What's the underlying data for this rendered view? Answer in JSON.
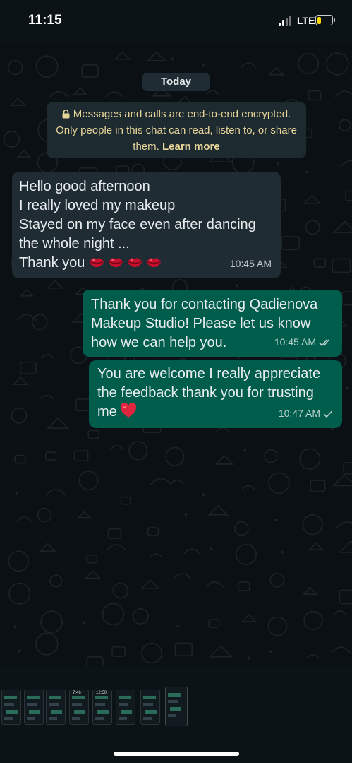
{
  "status_bar": {
    "time": "11:15",
    "network": "LTE",
    "battery_level": 0.25
  },
  "date_chip": "Today",
  "encryption_notice": {
    "text": "Messages and calls are end-to-end encrypted. Only people in this chat can read, listen to, or share them.",
    "link": "Learn more",
    "color": "#e8d59a"
  },
  "messages": [
    {
      "direction": "incoming",
      "lines": [
        "Hello good afternoon",
        "I really loved my makeup",
        "Stayed on my face even after dancing",
        "the whole night ...",
        "Thank you"
      ],
      "emoji": [
        "lips",
        "lips",
        "lips",
        "lips"
      ],
      "time": "10:45 AM"
    },
    {
      "direction": "outgoing",
      "text": "Thank you for contacting Qadienova Makeup Studio! Please let us know how we can help you.",
      "time": "10:45 AM",
      "status": "double-check"
    },
    {
      "direction": "outgoing",
      "text": "You are welcome I really appreciate the feedback thank you for trusting me",
      "emoji": [
        "red-heart"
      ],
      "time": "10:47 AM",
      "status": "single-check"
    }
  ],
  "thumbnails": {
    "count": 8,
    "labels": [
      "",
      "",
      "",
      "7:46",
      "12:50",
      "",
      "",
      ""
    ],
    "selected_index": 7
  },
  "colors": {
    "incoming_bubble": "#1f2c33",
    "outgoing_bubble": "#005c4b",
    "background": "#0b1014"
  }
}
